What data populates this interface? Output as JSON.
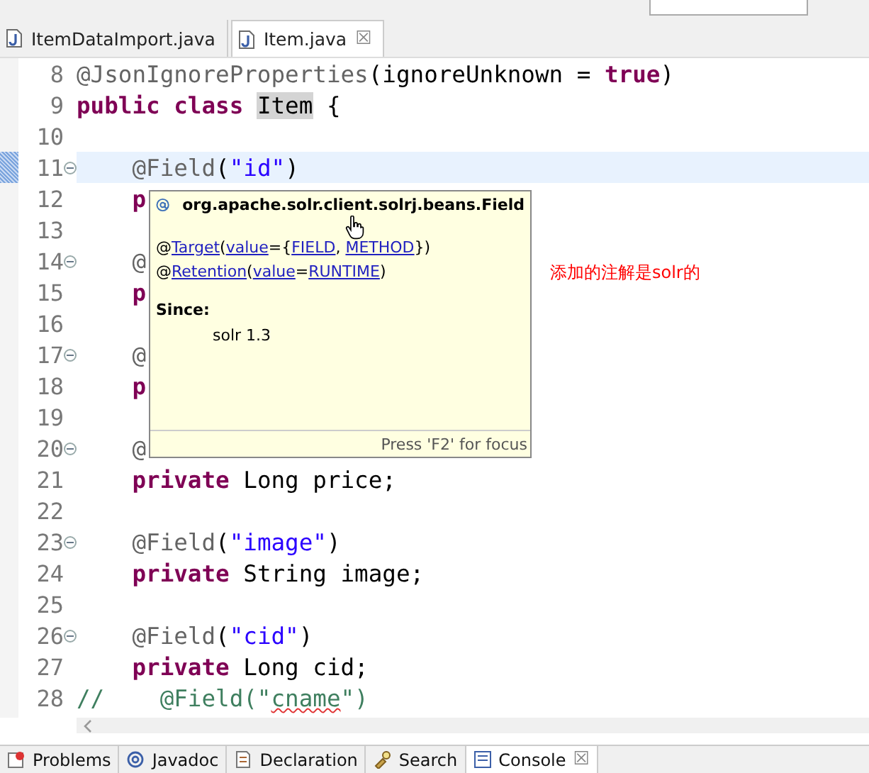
{
  "editor_tabs": [
    {
      "label": "ItemDataImport.java",
      "selected": false
    },
    {
      "label": "Item.java",
      "selected": true,
      "close": "☒"
    }
  ],
  "code_lines": [
    {
      "n": "8",
      "fold": false,
      "current": false,
      "tokens": [
        {
          "t": "@JsonIgnoreProperties",
          "kind": "annotation"
        },
        {
          "t": "(ignoreUnknown = ",
          "kind": "plain"
        },
        {
          "t": "true",
          "kind": "keyword"
        },
        {
          "t": ")",
          "kind": "plain"
        }
      ]
    },
    {
      "n": "9",
      "fold": false,
      "current": false,
      "tokens": [
        {
          "t": "public class ",
          "kind": "keyword"
        },
        {
          "t": "Item",
          "kind": "occurrence"
        },
        {
          "t": " {",
          "kind": "plain"
        }
      ]
    },
    {
      "n": "10",
      "fold": false,
      "current": false
    },
    {
      "n": "11",
      "fold": true,
      "current": true,
      "tokens": [
        {
          "t": "    @Field",
          "kind": "annotation"
        },
        {
          "t": "(",
          "kind": "plain"
        },
        {
          "t": "\"id\"",
          "kind": "string"
        },
        {
          "t": ")",
          "kind": "plain"
        }
      ]
    },
    {
      "n": "12",
      "fold": false,
      "current": false,
      "tokens": [
        {
          "t": "    p",
          "kind": "keyword"
        }
      ]
    },
    {
      "n": "13",
      "fold": false,
      "current": false
    },
    {
      "n": "14",
      "fold": true,
      "current": false,
      "tokens": [
        {
          "t": "    @",
          "kind": "annotation"
        }
      ]
    },
    {
      "n": "15",
      "fold": false,
      "current": false,
      "tokens": [
        {
          "t": "    p",
          "kind": "keyword"
        }
      ]
    },
    {
      "n": "16",
      "fold": false,
      "current": false
    },
    {
      "n": "17",
      "fold": true,
      "current": false,
      "tokens": [
        {
          "t": "    @",
          "kind": "annotation"
        }
      ]
    },
    {
      "n": "18",
      "fold": false,
      "current": false,
      "tokens": [
        {
          "t": "    p",
          "kind": "keyword"
        }
      ]
    },
    {
      "n": "19",
      "fold": false,
      "current": false
    },
    {
      "n": "20",
      "fold": true,
      "current": false,
      "tokens": [
        {
          "t": "    @",
          "kind": "annotation"
        }
      ]
    },
    {
      "n": "21",
      "fold": false,
      "current": false,
      "tokens": [
        {
          "t": "    private ",
          "kind": "keyword"
        },
        {
          "t": "Long price;",
          "kind": "plain"
        }
      ]
    },
    {
      "n": "22",
      "fold": false,
      "current": false
    },
    {
      "n": "23",
      "fold": true,
      "current": false,
      "tokens": [
        {
          "t": "    @Field",
          "kind": "annotation"
        },
        {
          "t": "(",
          "kind": "plain"
        },
        {
          "t": "\"image\"",
          "kind": "string"
        },
        {
          "t": ")",
          "kind": "plain"
        }
      ]
    },
    {
      "n": "24",
      "fold": false,
      "current": false,
      "tokens": [
        {
          "t": "    private ",
          "kind": "keyword"
        },
        {
          "t": "String image;",
          "kind": "plain"
        }
      ]
    },
    {
      "n": "25",
      "fold": false,
      "current": false
    },
    {
      "n": "26",
      "fold": true,
      "current": false,
      "tokens": [
        {
          "t": "    @Field",
          "kind": "annotation"
        },
        {
          "t": "(",
          "kind": "plain"
        },
        {
          "t": "\"cid\"",
          "kind": "string"
        },
        {
          "t": ")",
          "kind": "plain"
        }
      ]
    },
    {
      "n": "27",
      "fold": false,
      "current": false,
      "tokens": [
        {
          "t": "    private ",
          "kind": "keyword"
        },
        {
          "t": "Long cid;",
          "kind": "plain"
        }
      ]
    },
    {
      "n": "28",
      "fold": false,
      "current": false,
      "tokens": [
        {
          "t": "//    @Field(\"",
          "kind": "comment"
        },
        {
          "t": "cname",
          "kind": "misspelled"
        },
        {
          "t": "\")",
          "kind": "comment"
        }
      ]
    }
  ],
  "hover_popup": {
    "title": "org.apache.solr.client.solrj.beans.Field",
    "annotations": [
      [
        {
          "t": "@",
          "link": false
        },
        {
          "t": "Target",
          "link": true
        },
        {
          "t": "(",
          "link": false
        },
        {
          "t": "value",
          "link": true
        },
        {
          "t": "={",
          "link": false
        },
        {
          "t": "FIELD",
          "link": true
        },
        {
          "t": ", ",
          "link": false
        },
        {
          "t": "METHOD",
          "link": true
        },
        {
          "t": "})",
          "link": false
        }
      ],
      [
        {
          "t": "@",
          "link": false
        },
        {
          "t": "Retention",
          "link": true
        },
        {
          "t": "(",
          "link": false
        },
        {
          "t": "value",
          "link": true
        },
        {
          "t": "=",
          "link": false
        },
        {
          "t": "RUNTIME",
          "link": true
        },
        {
          "t": ")",
          "link": false
        }
      ]
    ],
    "since_label": "Since:",
    "since_value": "solr 1.3",
    "footer": "Press 'F2' for focus"
  },
  "note": "添加的注解是solr的",
  "bottom_tabs": [
    {
      "label": "Problems",
      "selected": false
    },
    {
      "label": "Javadoc",
      "selected": false
    },
    {
      "label": "Declaration",
      "selected": false
    },
    {
      "label": "Search",
      "selected": false
    },
    {
      "label": "Console",
      "selected": true,
      "close": "☒"
    }
  ]
}
